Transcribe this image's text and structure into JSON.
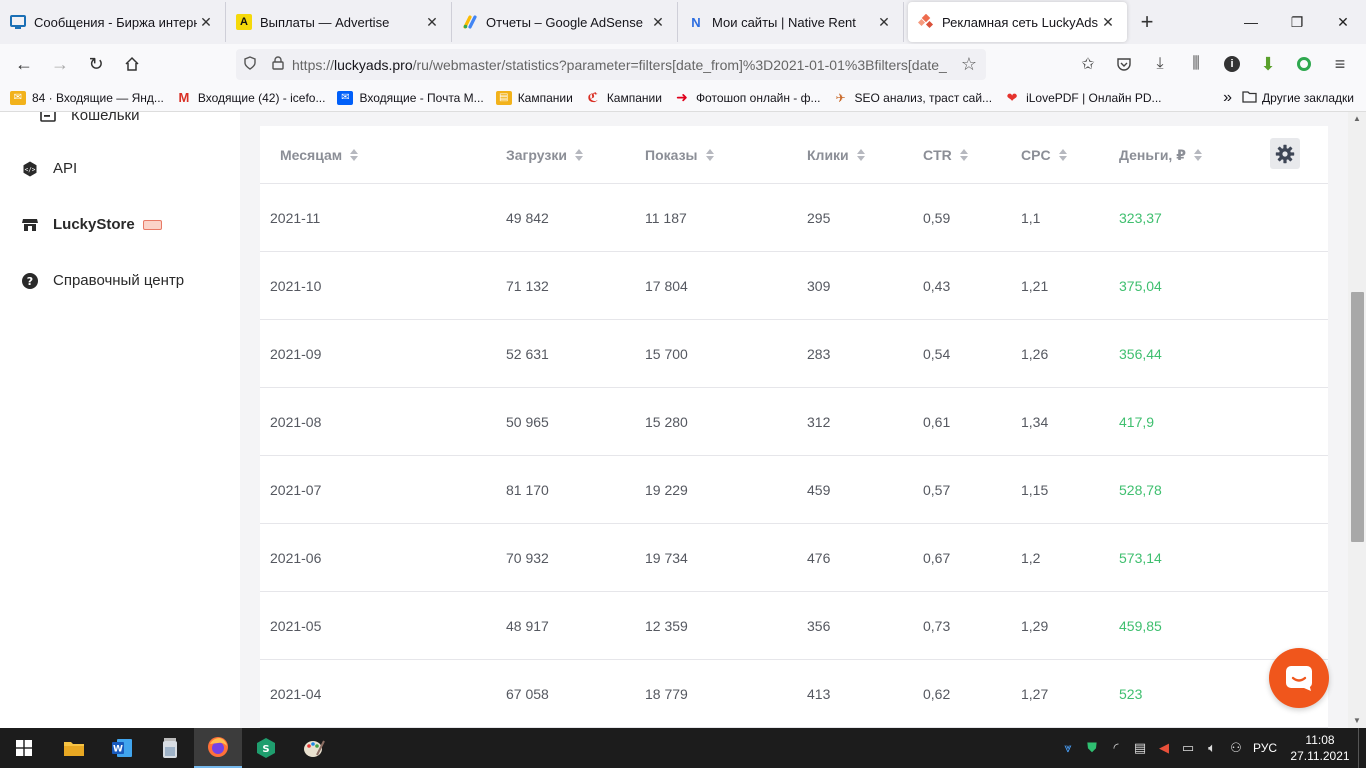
{
  "browser": {
    "tabs": [
      {
        "title": "Сообщения - Биржа интернет",
        "icon": "monitor-icon",
        "color": "#1a6fb5"
      },
      {
        "title": "Выплаты — Advertise",
        "icon": "advertise-icon",
        "color": "#f5d90a"
      },
      {
        "title": "Отчеты – Google AdSense",
        "icon": "adsense-icon",
        "color": "#4285f4"
      },
      {
        "title": "Мои сайты | Native Rent",
        "icon": "nativerent-icon",
        "color": "#2d6de0"
      },
      {
        "title": "Рекламная сеть LuckyAds",
        "icon": "luckyads-icon",
        "color": "#ee6b4d",
        "active": true
      }
    ],
    "url_prefix": "https://",
    "url_host": "luckyads.pro",
    "url_rest": "/ru/webmaster/statistics?parameter=filters[date_from]%3D2021-01-01%3Bfilters[date_",
    "bookmarks": [
      {
        "label": "84 · Входящие — Янд...",
        "icon": "mail-icon",
        "color": "#f2b21b"
      },
      {
        "label": "Входящие (42) - icefo...",
        "icon": "gmail-icon",
        "color": "#d93025"
      },
      {
        "label": "Входящие - Почта M...",
        "icon": "mailru-icon",
        "color": "#005ff9"
      },
      {
        "label": "Кампании",
        "icon": "campaign-icon",
        "color": "#f2b21b"
      },
      {
        "label": "Кампании",
        "icon": "campaign2-icon",
        "color": "#d93025"
      },
      {
        "label": "Фотошоп онлайн - ф...",
        "icon": "arrow-icon",
        "color": "#e0001b"
      },
      {
        "label": "SEO анализ, траст сай...",
        "icon": "seo-icon",
        "color": "#c96a2b"
      },
      {
        "label": "iLovePDF | Онлайн PD...",
        "icon": "pdf-icon",
        "color": "#e5322d"
      }
    ],
    "other_bookmarks": "Другие закладки",
    "overflow": "»"
  },
  "sidebar": {
    "items": [
      {
        "label": "Кошельки",
        "icon": "wallet-icon"
      },
      {
        "label": "API",
        "icon": "api-icon"
      },
      {
        "label": "LuckyStore",
        "icon": "store-icon",
        "bold": true,
        "badge": true
      },
      {
        "label": "Справочный центр",
        "icon": "help-icon"
      }
    ]
  },
  "table": {
    "columns": [
      "Месяцам",
      "Загрузки",
      "Показы",
      "Клики",
      "CTR",
      "CPC",
      "Деньги, ₽"
    ],
    "rows": [
      [
        "2021-11",
        "49 842",
        "11 187",
        "295",
        "0,59",
        "1,1",
        "323,37"
      ],
      [
        "2021-10",
        "71 132",
        "17 804",
        "309",
        "0,43",
        "1,21",
        "375,04"
      ],
      [
        "2021-09",
        "52 631",
        "15 700",
        "283",
        "0,54",
        "1,26",
        "356,44"
      ],
      [
        "2021-08",
        "50 965",
        "15 280",
        "312",
        "0,61",
        "1,34",
        "417,9"
      ],
      [
        "2021-07",
        "81 170",
        "19 229",
        "459",
        "0,57",
        "1,15",
        "528,78"
      ],
      [
        "2021-06",
        "70 932",
        "19 734",
        "476",
        "0,67",
        "1,2",
        "573,14"
      ],
      [
        "2021-05",
        "48 917",
        "12 359",
        "356",
        "0,73",
        "1,29",
        "459,85"
      ],
      [
        "2021-04",
        "67 058",
        "18 779",
        "413",
        "0,62",
        "1,27",
        "523"
      ]
    ]
  },
  "taskbar": {
    "time": "11:08",
    "date": "27.11.2021",
    "lang": "РУС"
  },
  "colors": {
    "money": "#3fbf6f",
    "chat": "#f0561c",
    "accent": "#ee6b4d"
  }
}
